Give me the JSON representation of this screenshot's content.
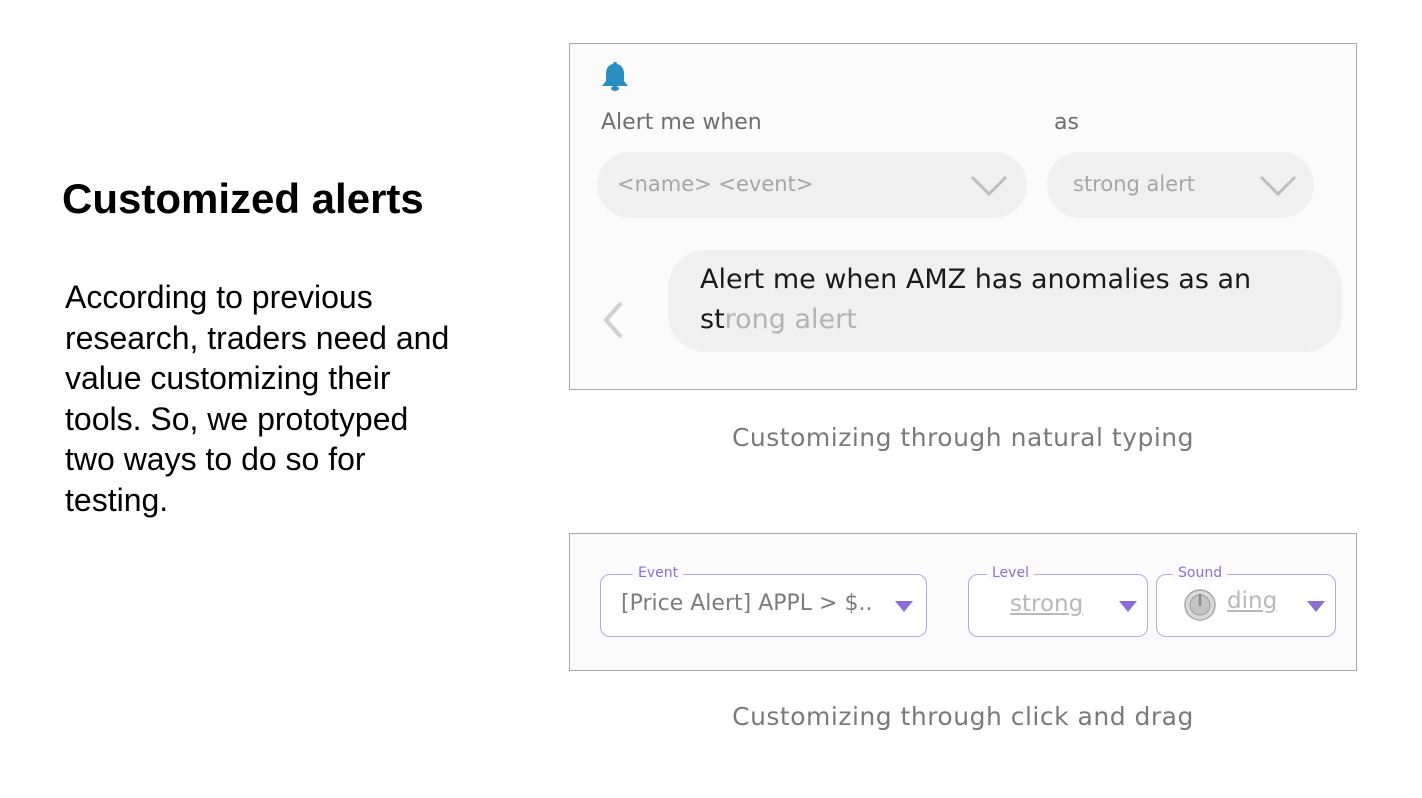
{
  "slide": {
    "title": "Customized alerts",
    "body_lines": [
      "According to previous",
      "research, traders need and",
      "value customizing their",
      "tools. So, we prototyped",
      "two ways to do so for",
      "testing."
    ]
  },
  "natural_typing": {
    "icon": "bell-icon",
    "label_when": "Alert me when",
    "label_as": "as",
    "event_dropdown": "<name> <event>",
    "level_dropdown": "strong alert",
    "typed_text": "Alert me when AMZ has anomalies as an st",
    "ghost_completion": "rong alert",
    "caption": "Customizing through natural typing"
  },
  "click_drag": {
    "event": {
      "legend": "Event",
      "value": "[Price Alert] APPL > $.."
    },
    "level": {
      "legend": "Level",
      "value": "strong"
    },
    "sound": {
      "legend": "Sound",
      "value": "ding",
      "icon": "volume-knob-icon"
    },
    "caption": "Customizing through click and drag"
  },
  "colors": {
    "bell": "#2a8fc0",
    "accent_purple": "#8b6fd6"
  }
}
